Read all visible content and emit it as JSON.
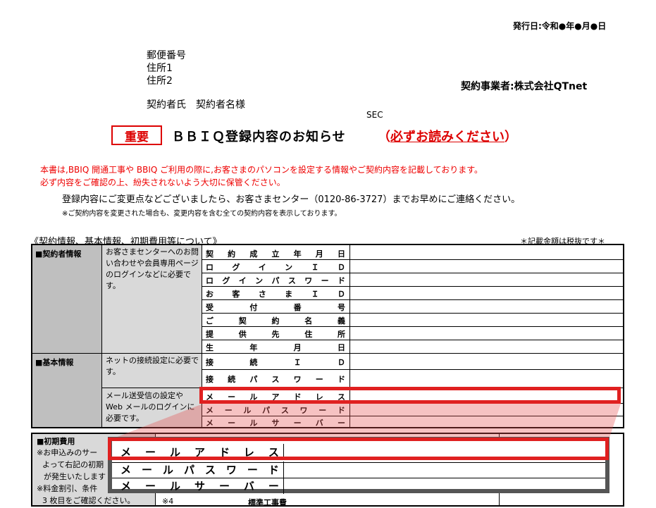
{
  "header": {
    "issue_date": "発行日:令和●年●月●日",
    "postal": "郵便番号",
    "address1": "住所1",
    "address2": "住所2",
    "contractor": "契約事業者:株式会社QTnet",
    "customer": "契約者氏　契約者名様",
    "sec": "SEC"
  },
  "title": {
    "badge": "重要",
    "main": "ＢＢＩＱ登録内容のお知らせ",
    "paren_open": "（",
    "must_read": "必ずお読みください",
    "paren_close": "）"
  },
  "notices": {
    "red1": "本書は,BBIQ 開通工事や BBIQ ご利用の際に,お客さまのパソコンを設定する情報やご契約内容を記載しております。",
    "red2": "必ず内容をご確認の上、紛失されないよう大切に保管ください。",
    "contact": "登録内容にご変更点などございましたら、お客さまセンター（0120-86-3727）までお早めにご連絡ください。",
    "small": "※ご契約内容を変更された場合も、変更内容を含む全ての契約内容を表示しております。"
  },
  "section": {
    "title": "《契約情報、基本情報、初期費用等について》",
    "tax_note": "＊記載金額は税抜です＊"
  },
  "table": {
    "cat_contract": "■契約者情報",
    "desc_contract": "お客さまセンターへのお問い合わせや会員専用ページのログインなどに必要です。",
    "contract_fields": [
      "契約成立年月日",
      "ログインＩＤ",
      "ログインパスワード",
      "お客さまＩＤ",
      "受付番号",
      "ご契約名義",
      "提供先住所",
      "生年月日"
    ],
    "cat_basic": "■基本情報",
    "desc_basic1": "ネットの接続設定に必要です。",
    "basic_fields1": [
      "接続ＩＤ",
      "接続パスワード"
    ],
    "desc_basic2": "メール送受信の設定や Web メールのログインに必要です。",
    "basic_fields2": [
      "メールアドレス",
      "メールパスワード",
      "メールサーバー"
    ]
  },
  "cost": {
    "line1": "■初期費用",
    "line2": "※お申込みのサー",
    "line3": "よって右記の初期",
    "line4": "が発生いたします",
    "line5": "※料金割引、条件",
    "line6": "3 枚目をご確認ください。",
    "note4": "※4",
    "std_fee": "標準工事費"
  },
  "zoom": {
    "fields": [
      "メールアドレス",
      "メールパスワード",
      "メールサーバー"
    ]
  }
}
